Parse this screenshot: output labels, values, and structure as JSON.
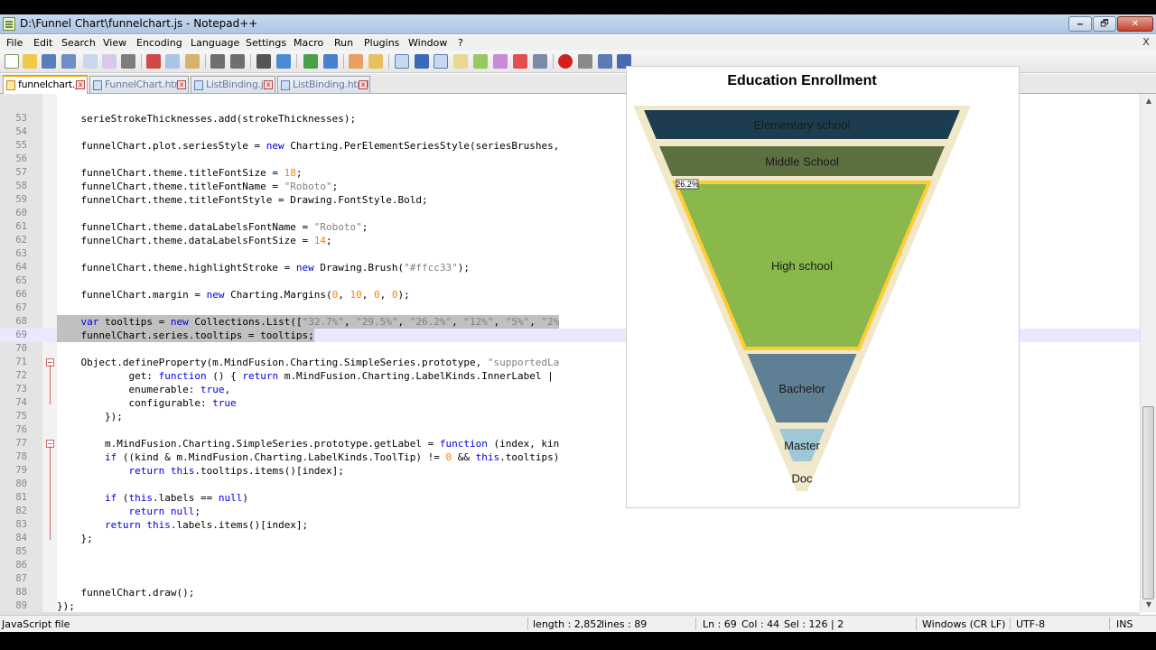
{
  "window": {
    "title": "D:\\Funnel Chart\\funnelchart.js - Notepad++",
    "minimize": "🗕",
    "maximize": "🗗",
    "close": "✕"
  },
  "menu": [
    "File",
    "Edit",
    "Search",
    "View",
    "Encoding",
    "Language",
    "Settings",
    "Macro",
    "Run",
    "Plugins",
    "Window",
    "?"
  ],
  "menu_close": "X",
  "tabs": [
    {
      "label": "funnelchart.js",
      "active": true
    },
    {
      "label": "FunnelChart.html",
      "active": false
    },
    {
      "label": "ListBinding.js",
      "active": false
    },
    {
      "label": "ListBinding.html",
      "active": false
    }
  ],
  "code_lines": [
    {
      "n": "53",
      "text": "    serieStrokeThicknesses.add(strokeThicknesses);"
    },
    {
      "n": "54",
      "text": ""
    },
    {
      "n": "55",
      "text": "    funnelChart.plot.seriesStyle = new Charting.PerElementSeriesStyle(seriesBrushes,"
    },
    {
      "n": "56",
      "text": ""
    },
    {
      "n": "57",
      "text": "    funnelChart.theme.titleFontSize = 18;"
    },
    {
      "n": "58",
      "text": "    funnelChart.theme.titleFontName = \"Roboto\";"
    },
    {
      "n": "59",
      "text": "    funnelChart.theme.titleFontStyle = Drawing.FontStyle.Bold;"
    },
    {
      "n": "60",
      "text": ""
    },
    {
      "n": "61",
      "text": "    funnelChart.theme.dataLabelsFontName = \"Roboto\";"
    },
    {
      "n": "62",
      "text": "    funnelChart.theme.dataLabelsFontSize = 14;"
    },
    {
      "n": "63",
      "text": ""
    },
    {
      "n": "64",
      "text": "    funnelChart.theme.highlightStroke = new Drawing.Brush(\"#ffcc33\");"
    },
    {
      "n": "65",
      "text": ""
    },
    {
      "n": "66",
      "text": "    funnelChart.margin = new Charting.Margins(0, 10, 0, 0);"
    },
    {
      "n": "67",
      "text": ""
    },
    {
      "n": "68",
      "text": "    var tooltips = new Collections.List([\"32.7%\", \"29.5%\", \"26.2%\", \"12%\", \"5%\", \"2%"
    },
    {
      "n": "69",
      "text": "    funnelChart.series.tooltips = tooltips;"
    },
    {
      "n": "70",
      "text": ""
    },
    {
      "n": "71",
      "text": "    Object.defineProperty(m.MindFusion.Charting.SimpleSeries.prototype, \"supportedLa"
    },
    {
      "n": "72",
      "text": "            get: function () { return m.MindFusion.Charting.LabelKinds.InnerLabel |"
    },
    {
      "n": "73",
      "text": "            enumerable: true,"
    },
    {
      "n": "74",
      "text": "            configurable: true"
    },
    {
      "n": "75",
      "text": "        });"
    },
    {
      "n": "76",
      "text": ""
    },
    {
      "n": "77",
      "text": "        m.MindFusion.Charting.SimpleSeries.prototype.getLabel = function (index, kin"
    },
    {
      "n": "78",
      "text": "        if ((kind & m.MindFusion.Charting.LabelKinds.ToolTip) != 0 && this.tooltips)"
    },
    {
      "n": "79",
      "text": "            return this.tooltips.items()[index];"
    },
    {
      "n": "80",
      "text": ""
    },
    {
      "n": "81",
      "text": "        if (this.labels == null)"
    },
    {
      "n": "82",
      "text": "            return null;"
    },
    {
      "n": "83",
      "text": "        return this.labels.items()[index];"
    },
    {
      "n": "84",
      "text": "    };"
    },
    {
      "n": "85",
      "text": ""
    },
    {
      "n": "86",
      "text": ""
    },
    {
      "n": "87",
      "text": ""
    },
    {
      "n": "88",
      "text": "    funnelChart.draw();"
    },
    {
      "n": "89",
      "text": "});"
    }
  ],
  "status": {
    "file_type": "JavaScript file",
    "length": "length : 2,852",
    "lines": "lines : 89",
    "ln": "Ln : 69",
    "col": "Col : 44",
    "sel": "Sel : 126 | 2",
    "eol": "Windows (CR LF)",
    "encoding": "UTF-8",
    "mode": "INS"
  },
  "chart_data": {
    "type": "funnel",
    "title": "Education Enrollment",
    "categories": [
      "Elementary school",
      "Middle School",
      "High school",
      "Bachelor",
      "Master",
      "Doc"
    ],
    "colors": [
      "#1c3d4f",
      "#5d7040",
      "#8bb84a",
      "#5f7f94",
      "#9ec8d8",
      "#f0ead2"
    ],
    "border_color": "#f0e8c8",
    "highlight_color": "#ffcc33",
    "highlighted_index": 2,
    "tooltip": "26.2%"
  }
}
